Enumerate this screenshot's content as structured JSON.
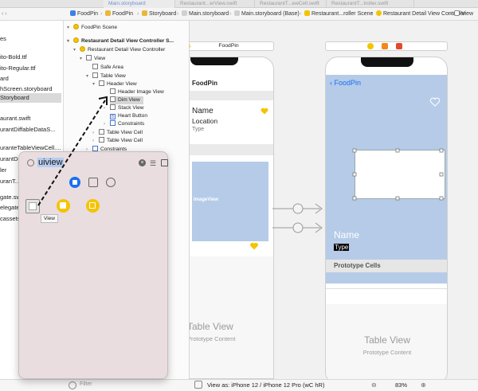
{
  "tabs": [
    {
      "label": "Main.storyboard",
      "active": true
    },
    {
      "label": "Restaurant...erView.swift",
      "active": false
    },
    {
      "label": "RestaurantT...ewCell.swift",
      "active": false
    },
    {
      "label": "RestaurantT...troller.swift",
      "active": false
    }
  ],
  "breadcrumbs": [
    "FoodPin",
    "FoodPin",
    "Storyboard",
    "Main.storyboard",
    "Main.storyboard (Base)",
    "Restaurant...roller Scene",
    "Restaurant Detail View Controller",
    "View"
  ],
  "navigator": {
    "items": [
      "es",
      "ito-Bold.ttf",
      "ito-Regular.ttf",
      "ard",
      "hScreen.storyboard",
      "Storyboard",
      "aurant.swift",
      "urantDiffableDataS...",
      "uranteTableViewCell....",
      "urantDe...",
      "ler",
      "uranT...",
      "gate.sw...",
      "elegate...",
      "cassets"
    ],
    "selected_index": 5
  },
  "outline": {
    "items": [
      {
        "label": "FoodPin Scene",
        "indent": 0,
        "icon": "scene",
        "expanded": true
      },
      {
        "label": "Restaurant Detail View Controller S...",
        "indent": 0,
        "icon": "scene",
        "expanded": true
      },
      {
        "label": "Restaurant Detail View Controller",
        "indent": 1,
        "icon": "controller",
        "expanded": true
      },
      {
        "label": "View",
        "indent": 2,
        "icon": "view",
        "expanded": true
      },
      {
        "label": "Safe Area",
        "indent": 3,
        "icon": "view",
        "expanded": false
      },
      {
        "label": "Table View",
        "indent": 3,
        "icon": "view",
        "expanded": true
      },
      {
        "label": "Header View",
        "indent": 4,
        "icon": "view",
        "expanded": true
      },
      {
        "label": "Header Image View",
        "indent": 5,
        "icon": "image",
        "expanded": false
      },
      {
        "label": "Dim View",
        "indent": 5,
        "icon": "view",
        "expanded": false,
        "selected": true
      },
      {
        "label": "Stack View",
        "indent": 5,
        "icon": "view",
        "expanded": false
      },
      {
        "label": "Heart Button",
        "indent": 5,
        "icon": "button",
        "expanded": false
      },
      {
        "label": "Constraints",
        "indent": 5,
        "icon": "constraints",
        "expanded": false
      },
      {
        "label": "Table View Cell",
        "indent": 4,
        "icon": "view",
        "expanded": false
      },
      {
        "label": "Table View Cell",
        "indent": 4,
        "icon": "view",
        "expanded": false
      },
      {
        "label": "Constraints",
        "indent": 3,
        "icon": "constraints",
        "expanded": false
      }
    ]
  },
  "library": {
    "search_value": "uiview",
    "tooltip": "View",
    "filter_placeholder": "Filter"
  },
  "canvas": {
    "left_scene": {
      "title": "FoodPin",
      "nav_title": "FoodPin",
      "cell_name": "Name",
      "cell_location": "Location",
      "cell_type": "Type",
      "image_label": "ImageView",
      "table_view": "Table View",
      "prototype_content": "Prototype Content"
    },
    "right_scene": {
      "back_label": "FoodPin",
      "header_name": "Name",
      "header_type": "Type",
      "section_label": "Prototype Cells",
      "table_view": "Table View",
      "prototype_content": "Prototype Content"
    },
    "bottom": {
      "view_as": "View as: iPhone 12 / iPhone 12 Pro (wC hR)",
      "zoom": "83%"
    }
  },
  "colors": {
    "accent": "#1a6ff1",
    "header_blue": "#b5cbe8",
    "heart_yellow": "#f5c400",
    "library_bg": "#e9dde0"
  }
}
